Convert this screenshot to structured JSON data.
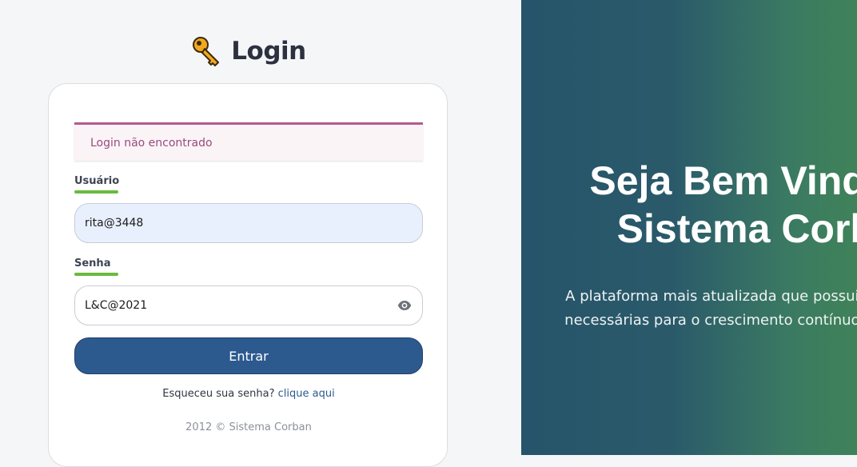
{
  "header": {
    "title": "Login"
  },
  "alert": {
    "message": "Login não encontrado"
  },
  "form": {
    "usuario_label": "Usuário",
    "usuario_value": "rita@3448",
    "senha_label": "Senha",
    "senha_value": "L&C@2021",
    "submit_label": "Entrar"
  },
  "forgot": {
    "prompt": "Esqueceu sua senha?",
    "link": "clique aqui"
  },
  "footer": {
    "copyright": "2012 © Sistema Corban"
  },
  "welcome": {
    "heading_line1": "Seja Bem Vindo ao",
    "heading_line2": "Sistema Corban",
    "tagline_line1": "A plataforma mais atualizada que possui as ferramentas",
    "tagline_line2": "necessárias para o crescimento contínuo do seu negócio"
  },
  "icons": {
    "title_icon": "key-icon",
    "password_toggle": "eye-icon"
  },
  "colors": {
    "accent": "#2c5a8f",
    "label_underline": "#6aba3f",
    "alert_border": "#b55a92",
    "gradient_start": "#26546a",
    "gradient_end": "#3f8259"
  }
}
